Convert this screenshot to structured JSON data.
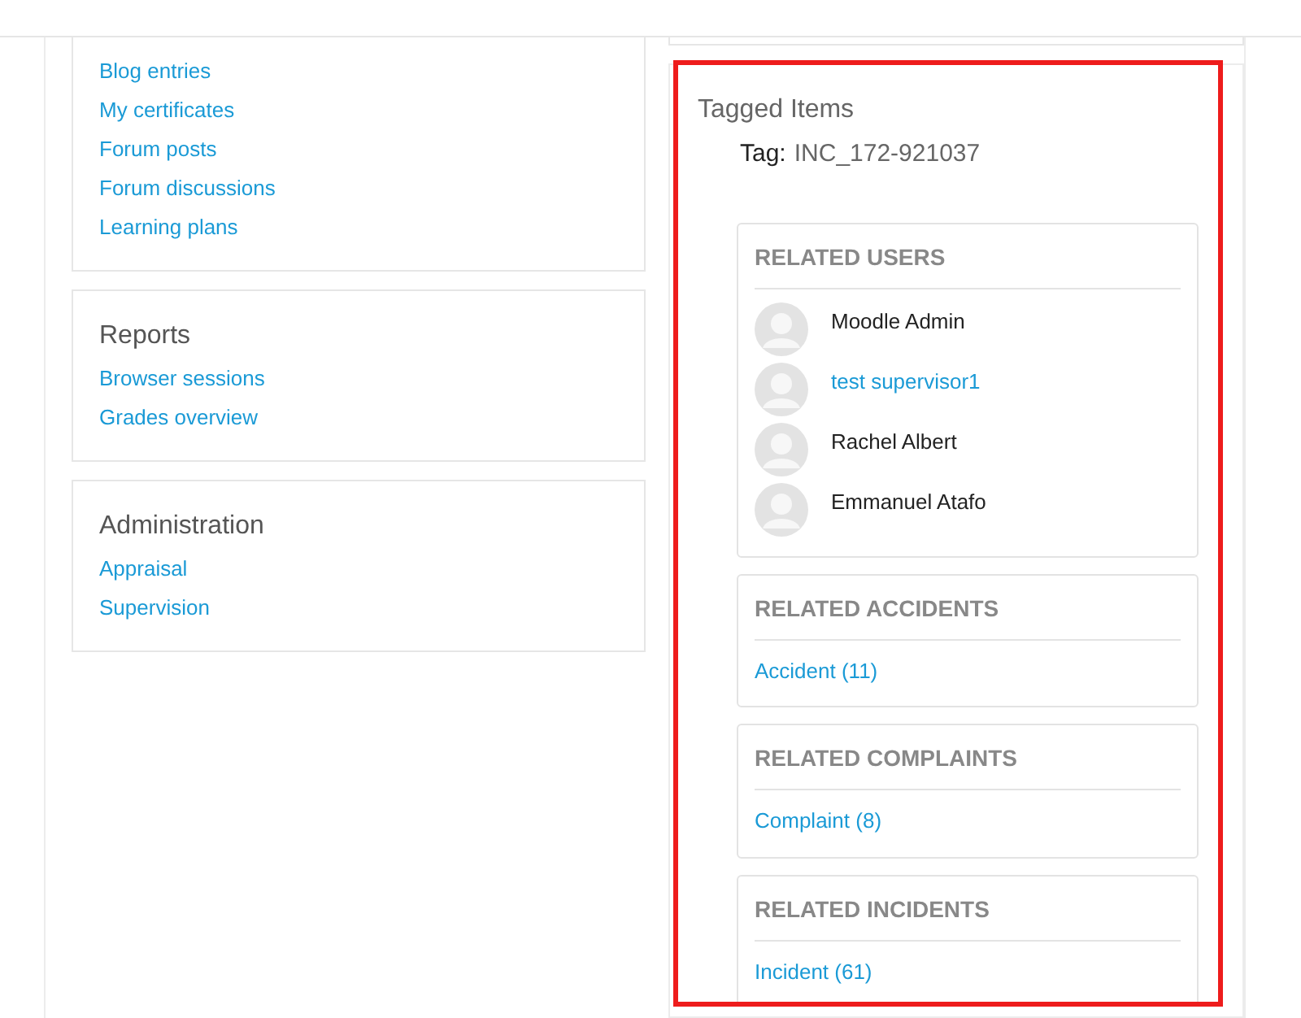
{
  "left_blocks": [
    {
      "links": [
        "Blog entries",
        "My certificates",
        "Forum posts",
        "Forum discussions",
        "Learning plans"
      ]
    },
    {
      "title": "Reports",
      "links": [
        "Browser sessions",
        "Grades overview"
      ]
    },
    {
      "title": "Administration",
      "links": [
        "Appraisal",
        "Supervision"
      ]
    }
  ],
  "tagged_items": {
    "title": "Tagged Items",
    "tag_label": "Tag:",
    "tag_value": "INC_172-921037",
    "sections": [
      {
        "kind": "users",
        "heading": "RELATED USERS",
        "users": [
          {
            "name": "Moodle Admin",
            "linked": false
          },
          {
            "name": "test supervisor1",
            "linked": true
          },
          {
            "name": "Rachel Albert",
            "linked": false
          },
          {
            "name": "Emmanuel Atafo",
            "linked": false
          }
        ]
      },
      {
        "kind": "links",
        "heading": "RELATED ACCIDENTS",
        "links": [
          "Accident (11)"
        ]
      },
      {
        "kind": "links",
        "heading": "RELATED COMPLAINTS",
        "links": [
          "Complaint (8)"
        ]
      },
      {
        "kind": "links",
        "heading": "RELATED INCIDENTS",
        "links": [
          "Incident (61)"
        ]
      }
    ]
  }
}
